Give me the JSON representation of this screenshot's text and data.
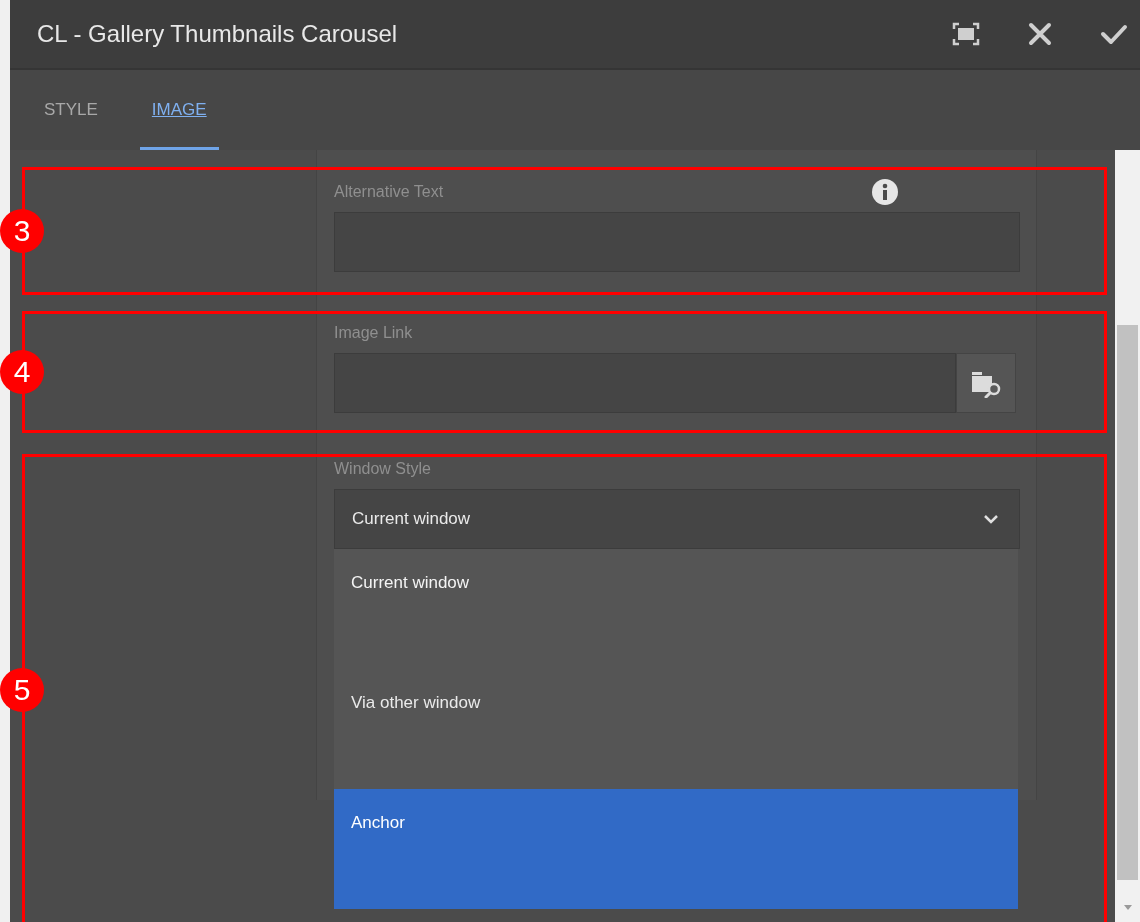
{
  "dialog": {
    "title": "CL - Gallery Thumbnails Carousel"
  },
  "tabs": [
    {
      "label": "STYLE",
      "selected": false
    },
    {
      "label": "IMAGE",
      "selected": true
    }
  ],
  "fields": {
    "alt_text": {
      "label": "Alternative Text"
    },
    "image_link": {
      "label": "Image Link"
    },
    "window_style": {
      "label": "Window Style",
      "value": "Current window",
      "expanded": true,
      "options": [
        {
          "label": "Current window",
          "selected": true,
          "highlighted": false
        },
        {
          "label": "Via other window",
          "selected": false,
          "highlighted": false
        },
        {
          "label": "Anchor",
          "selected": false,
          "highlighted": true
        }
      ]
    }
  },
  "annotations": [
    {
      "number": "3"
    },
    {
      "number": "4"
    },
    {
      "number": "5"
    }
  ]
}
